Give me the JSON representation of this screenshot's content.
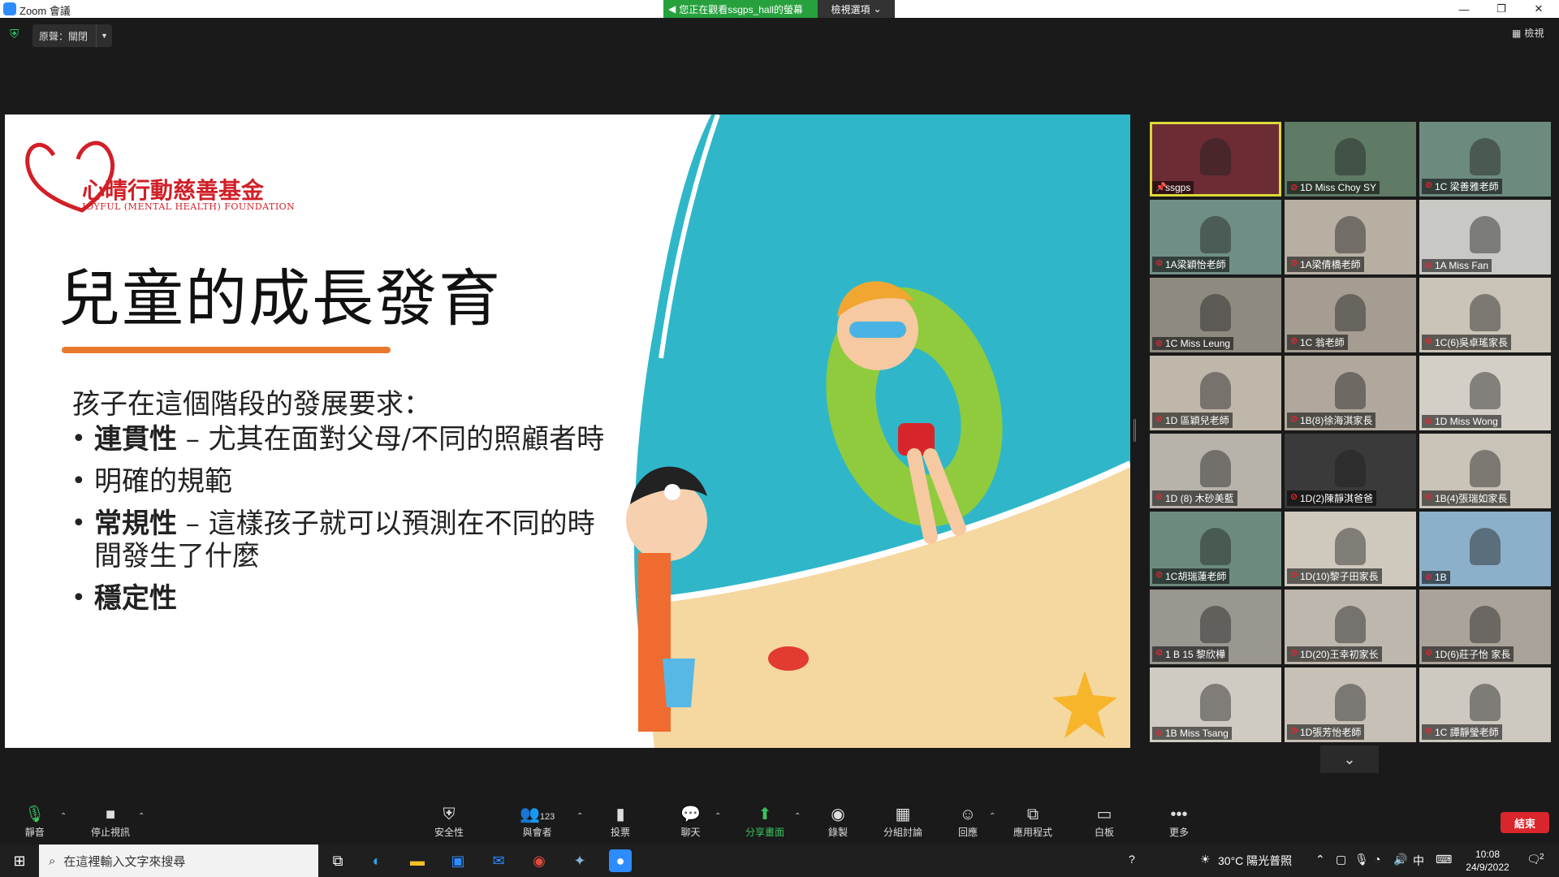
{
  "window": {
    "title": "Zoom 會議",
    "viewing_banner": "您正在觀看ssgps_hall的螢幕",
    "view_options": "檢視選項",
    "minimize": "—",
    "restore": "❐",
    "close": "✕"
  },
  "meeting": {
    "original_sound": "原聲：關閉",
    "view_label": "檢視"
  },
  "slide": {
    "logo_text": "心晴行動慈善基金",
    "logo_sub": "JOYFUL (MENTAL HEALTH) FOUNDATION",
    "title": "兒童的成長發育",
    "subtitle": "孩子在這個階段的發展要求：",
    "bullets": [
      {
        "bold": "連貫性",
        "text": " – 尤其在面對父母/不同的照顧者時"
      },
      {
        "bold": "",
        "text": "明確的規範"
      },
      {
        "bold": "常規性",
        "text": " – 這樣孩子就可以預測在不同的時"
      },
      {
        "bold": "",
        "text": "間發生了什麼"
      },
      {
        "bold": "穩定性",
        "text": ""
      }
    ]
  },
  "participants": [
    "ssgps",
    "1D Miss Choy SY",
    "1C 梁善雅老師",
    "1A梁穎怡老師",
    "1A梁倩橋老師",
    "1A Miss Fan",
    "1C Miss Leung",
    "1C 翁老師",
    "1C(6)吳卓瑤家長",
    "1D 區穎兒老師",
    "1B(8)徐海淇家長",
    "1D Miss Wong",
    "1D (8) 木砂美藍",
    "1D(2)陳靜淇爸爸",
    "1B(4)張瑞如家長",
    "1C胡瑞蓮老師",
    "1D(10)黎子田家長",
    "1B",
    "1 B 15 黎欣樺",
    "1D(20)王幸初家长",
    "1D(6)莊子怡 家長",
    "1B Miss Tsang",
    "1D張芳怡老師",
    "1C 譚靜瑩老師"
  ],
  "toolbar": {
    "mute": "靜音",
    "stop_video": "停止視訊",
    "security": "安全性",
    "participants": "與會者",
    "participant_count": "123",
    "polls": "投票",
    "chat": "聊天",
    "share": "分享畫面",
    "record": "錄製",
    "breakout": "分組討論",
    "reactions": "回應",
    "apps": "應用程式",
    "whiteboard": "白板",
    "more": "更多",
    "end": "結束"
  },
  "taskbar": {
    "search_placeholder": "在這裡輸入文字來搜尋",
    "weather": "30°C  陽光普照",
    "ime": "中",
    "time": "10:08",
    "date": "24/9/2022",
    "notifications": "2"
  }
}
